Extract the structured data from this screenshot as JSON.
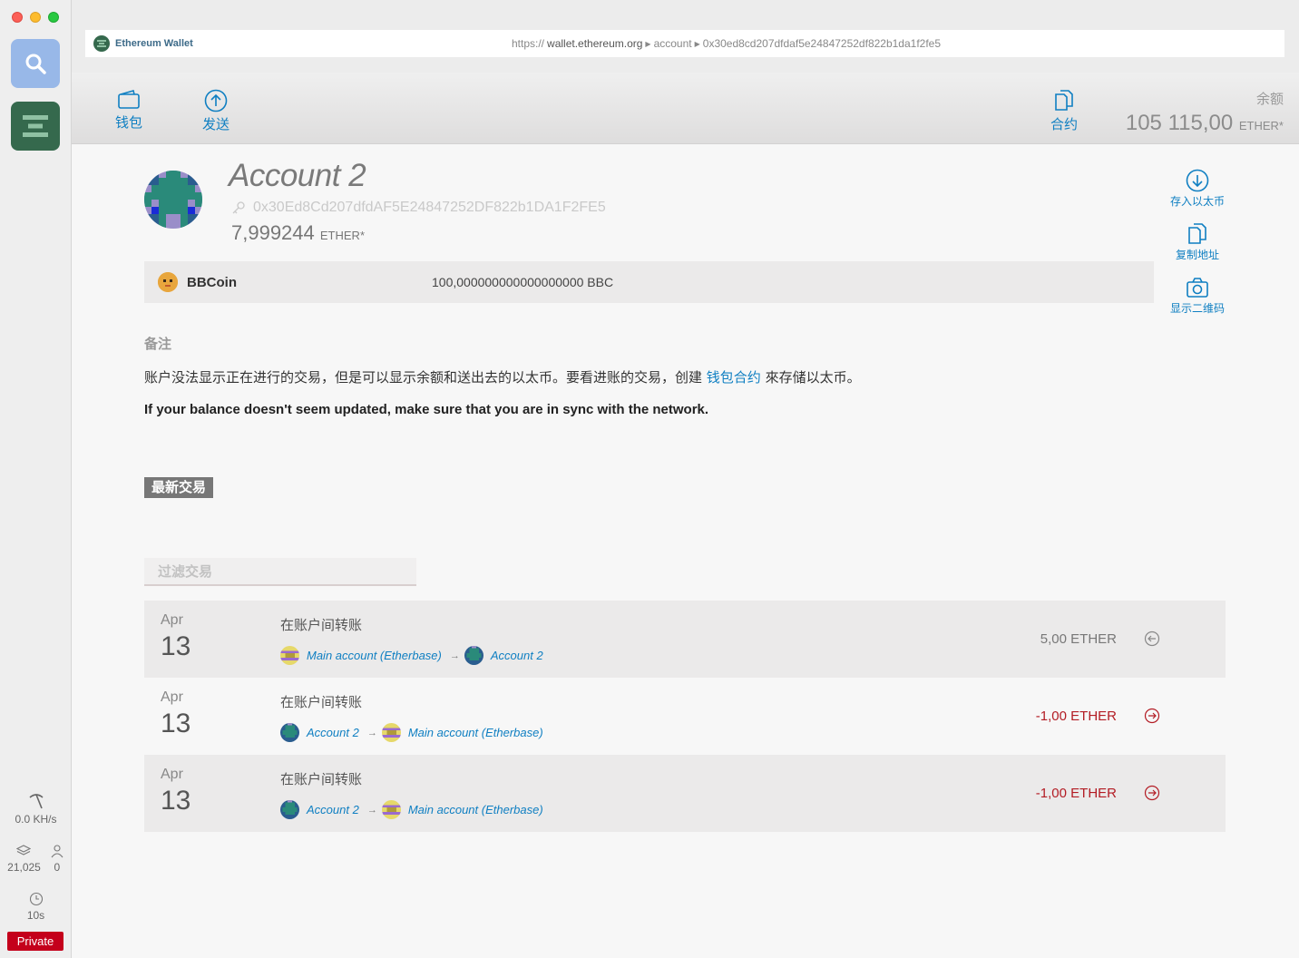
{
  "dock": {
    "hashrate": "0.0 KH/s",
    "block": "21,025",
    "peers": "0",
    "last_block_time": "10s",
    "network": "Private"
  },
  "urlbar": {
    "app_name": "Ethereum Wallet",
    "scheme": "https://",
    "host": "wallet.ethereum.org",
    "crumb_1": "account",
    "crumb_2": "0x30ed8cd207dfdaf5e24847252df822b1da1f2fe5"
  },
  "header": {
    "nav_wallet": "钱包",
    "nav_send": "发送",
    "nav_contracts": "合约",
    "balance_label": "余额",
    "balance_value": "105 115,00",
    "balance_unit": "ETHER*"
  },
  "account": {
    "name": "Account 2",
    "address": "0x30Ed8Cd207dfdAF5E24847252DF822b1DA1F2FE5",
    "balance": "7,999244",
    "balance_unit": "ETHER*"
  },
  "actions": {
    "deposit": "存入以太币",
    "copy_address": "复制地址",
    "show_qr": "显示二维码"
  },
  "token": {
    "name": "BBCoin",
    "amount": "100,000000000000000000 BBC"
  },
  "notes": {
    "title": "备注",
    "text_before": "账户没法显示正在进行的交易，但是可以显示余额和送出去的以太币。要看进账的交易，创建",
    "link": "钱包合约",
    "text_after": "來存储以太币。",
    "warning": "If your balance doesn't seem updated, make sure that you are in sync with the network."
  },
  "latest": {
    "title": "最新交易",
    "filter_placeholder": "过滤交易"
  },
  "transactions": [
    {
      "month": "Apr",
      "day": "13",
      "title": "在账户间转账",
      "from": "Main account (Etherbase)",
      "to": "Account 2",
      "amount": "5,00 ETHER",
      "direction": "incoming"
    },
    {
      "month": "Apr",
      "day": "13",
      "title": "在账户间转账",
      "from": "Account 2",
      "to": "Main account (Etherbase)",
      "amount": "-1,00 ETHER",
      "direction": "outgoing"
    },
    {
      "month": "Apr",
      "day": "13",
      "title": "在账户间转账",
      "from": "Account 2",
      "to": "Main account (Etherbase)",
      "amount": "-1,00 ETHER",
      "direction": "outgoing"
    }
  ],
  "colors": {
    "accent": "#0f7fc2",
    "negative": "#b31c24",
    "private_badge": "#c4001b"
  }
}
